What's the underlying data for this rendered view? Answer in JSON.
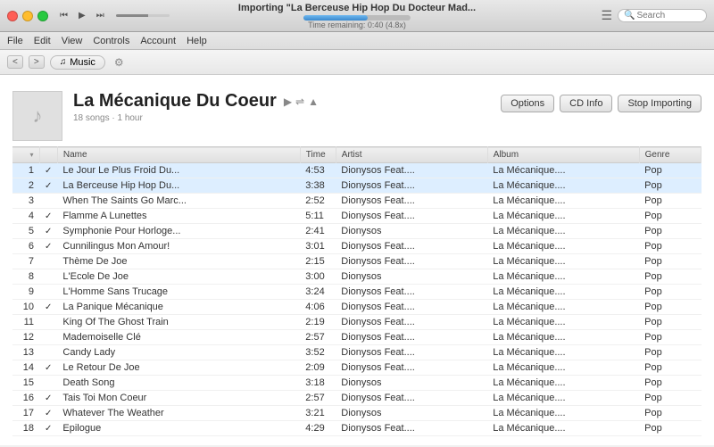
{
  "titlebar": {
    "importing_label": "Importing \"La Berceuse Hip Hop Du Docteur Mad...",
    "time_remaining": "Time remaining: 0:40 (4.8x)",
    "search_placeholder": "Search"
  },
  "menubar": {
    "items": [
      "File",
      "Edit",
      "View",
      "Controls",
      "Account",
      "Help"
    ]
  },
  "toolbar": {
    "nav_back": "<",
    "nav_forward": ">",
    "breadcrumb_label": "Music"
  },
  "album": {
    "title": "La Mécanique Du Coeur",
    "subtitle": "18 songs · 1 hour",
    "art_icon": "♪",
    "options_label": "Options",
    "cd_info_label": "CD Info",
    "stop_importing_label": "Stop Importing"
  },
  "table": {
    "headers": [
      "",
      "",
      "Name",
      "Time",
      "Artist",
      "Album",
      "Genre"
    ],
    "songs": [
      {
        "num": "1",
        "status": "✓",
        "status_class": "status-green",
        "name": "Le Jour Le Plus Froid Du...",
        "time": "4:53",
        "artist": "Dionysos Feat....",
        "album": "La Mécanique....",
        "genre": "Pop",
        "importing": true
      },
      {
        "num": "2",
        "status": "✓",
        "status_class": "status-orange",
        "name": "La Berceuse Hip Hop Du...",
        "time": "3:38",
        "artist": "Dionysos Feat....",
        "album": "La Mécanique....",
        "genre": "Pop",
        "importing": true
      },
      {
        "num": "3",
        "status": "",
        "status_class": "",
        "name": "When The Saints Go Marc...",
        "time": "2:52",
        "artist": "Dionysos Feat....",
        "album": "La Mécanique....",
        "genre": "Pop",
        "importing": false
      },
      {
        "num": "4",
        "status": "✓",
        "status_class": "status-green",
        "name": "Flamme A Lunettes",
        "time": "5:11",
        "artist": "Dionysos Feat....",
        "album": "La Mécanique....",
        "genre": "Pop",
        "importing": false
      },
      {
        "num": "5",
        "status": "✓",
        "status_class": "status-green",
        "name": "Symphonie Pour Horloge...",
        "time": "2:41",
        "artist": "Dionysos",
        "album": "La Mécanique....",
        "genre": "Pop",
        "importing": false
      },
      {
        "num": "6",
        "status": "✓",
        "status_class": "status-green",
        "name": "Cunnilingus Mon Amour!",
        "time": "3:01",
        "artist": "Dionysos Feat....",
        "album": "La Mécanique....",
        "genre": "Pop",
        "importing": false
      },
      {
        "num": "7",
        "status": "",
        "status_class": "",
        "name": "Thème De Joe",
        "time": "2:15",
        "artist": "Dionysos Feat....",
        "album": "La Mécanique....",
        "genre": "Pop",
        "importing": false
      },
      {
        "num": "8",
        "status": "",
        "status_class": "",
        "name": "L'Ecole De Joe",
        "time": "3:00",
        "artist": "Dionysos",
        "album": "La Mécanique....",
        "genre": "Pop",
        "importing": false
      },
      {
        "num": "9",
        "status": "",
        "status_class": "",
        "name": "L'Homme Sans Trucage",
        "time": "3:24",
        "artist": "Dionysos Feat....",
        "album": "La Mécanique....",
        "genre": "Pop",
        "importing": false
      },
      {
        "num": "10",
        "status": "✓",
        "status_class": "status-green",
        "name": "La Panique Mécanique",
        "time": "4:06",
        "artist": "Dionysos Feat....",
        "album": "La Mécanique....",
        "genre": "Pop",
        "importing": false
      },
      {
        "num": "11",
        "status": "",
        "status_class": "",
        "name": "King Of The Ghost Train",
        "time": "2:19",
        "artist": "Dionysos Feat....",
        "album": "La Mécanique....",
        "genre": "Pop",
        "importing": false
      },
      {
        "num": "12",
        "status": "",
        "status_class": "",
        "name": "Mademoiselle Clé",
        "time": "2:57",
        "artist": "Dionysos Feat....",
        "album": "La Mécanique....",
        "genre": "Pop",
        "importing": false
      },
      {
        "num": "13",
        "status": "",
        "status_class": "",
        "name": "Candy Lady",
        "time": "3:52",
        "artist": "Dionysos Feat....",
        "album": "La Mécanique....",
        "genre": "Pop",
        "importing": false
      },
      {
        "num": "14",
        "status": "✓",
        "status_class": "status-green",
        "name": "Le Retour De Joe",
        "time": "2:09",
        "artist": "Dionysos Feat....",
        "album": "La Mécanique....",
        "genre": "Pop",
        "importing": false
      },
      {
        "num": "15",
        "status": "",
        "status_class": "",
        "name": "Death Song",
        "time": "3:18",
        "artist": "Dionysos",
        "album": "La Mécanique....",
        "genre": "Pop",
        "importing": false
      },
      {
        "num": "16",
        "status": "✓",
        "status_class": "status-green",
        "name": "Tais Toi Mon Coeur",
        "time": "2:57",
        "artist": "Dionysos Feat....",
        "album": "La Mécanique....",
        "genre": "Pop",
        "importing": false
      },
      {
        "num": "17",
        "status": "✓",
        "status_class": "status-green",
        "name": "Whatever The Weather",
        "time": "3:21",
        "artist": "Dionysos",
        "album": "La Mécanique....",
        "genre": "Pop",
        "importing": false
      },
      {
        "num": "18",
        "status": "✓",
        "status_class": "status-green",
        "name": "Epilogue",
        "time": "4:29",
        "artist": "Dionysos Feat....",
        "album": "La Mécanique....",
        "genre": "Pop",
        "importing": false
      }
    ]
  }
}
